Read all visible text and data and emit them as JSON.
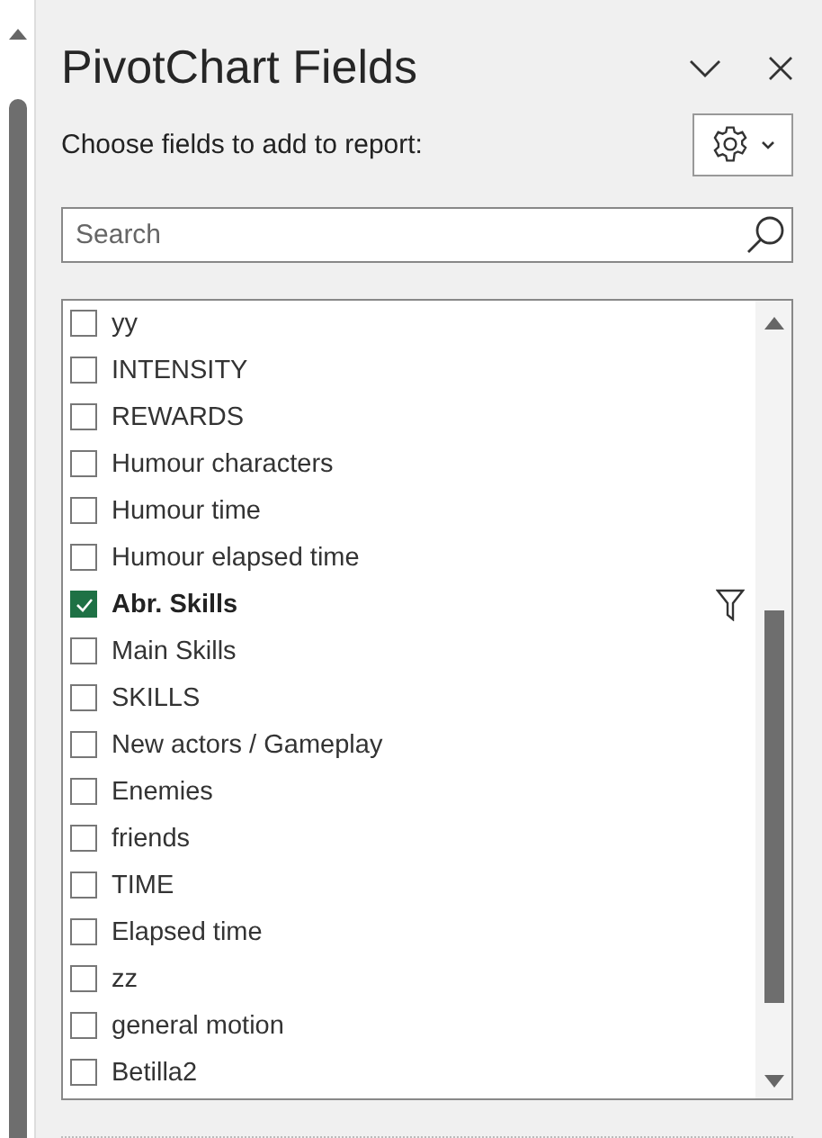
{
  "panel": {
    "title": "PivotChart Fields",
    "prompt": "Choose fields to add to report:"
  },
  "search": {
    "placeholder": "Search"
  },
  "fields": [
    {
      "label": "yy",
      "checked": false,
      "filtered": false
    },
    {
      "label": "INTENSITY",
      "checked": false,
      "filtered": false
    },
    {
      "label": "REWARDS",
      "checked": false,
      "filtered": false
    },
    {
      "label": "Humour characters",
      "checked": false,
      "filtered": false
    },
    {
      "label": "Humour time",
      "checked": false,
      "filtered": false
    },
    {
      "label": "Humour elapsed time",
      "checked": false,
      "filtered": false
    },
    {
      "label": "Abr. Skills",
      "checked": true,
      "filtered": true
    },
    {
      "label": "Main Skills",
      "checked": false,
      "filtered": false
    },
    {
      "label": "SKILLS",
      "checked": false,
      "filtered": false
    },
    {
      "label": "New actors / Gameplay",
      "checked": false,
      "filtered": false
    },
    {
      "label": "Enemies",
      "checked": false,
      "filtered": false
    },
    {
      "label": "friends",
      "checked": false,
      "filtered": false
    },
    {
      "label": "TIME",
      "checked": false,
      "filtered": false
    },
    {
      "label": "Elapsed time",
      "checked": false,
      "filtered": false
    },
    {
      "label": "zz",
      "checked": false,
      "filtered": false
    },
    {
      "label": "general motion",
      "checked": false,
      "filtered": false
    },
    {
      "label": "Betilla2",
      "checked": false,
      "filtered": false
    }
  ]
}
